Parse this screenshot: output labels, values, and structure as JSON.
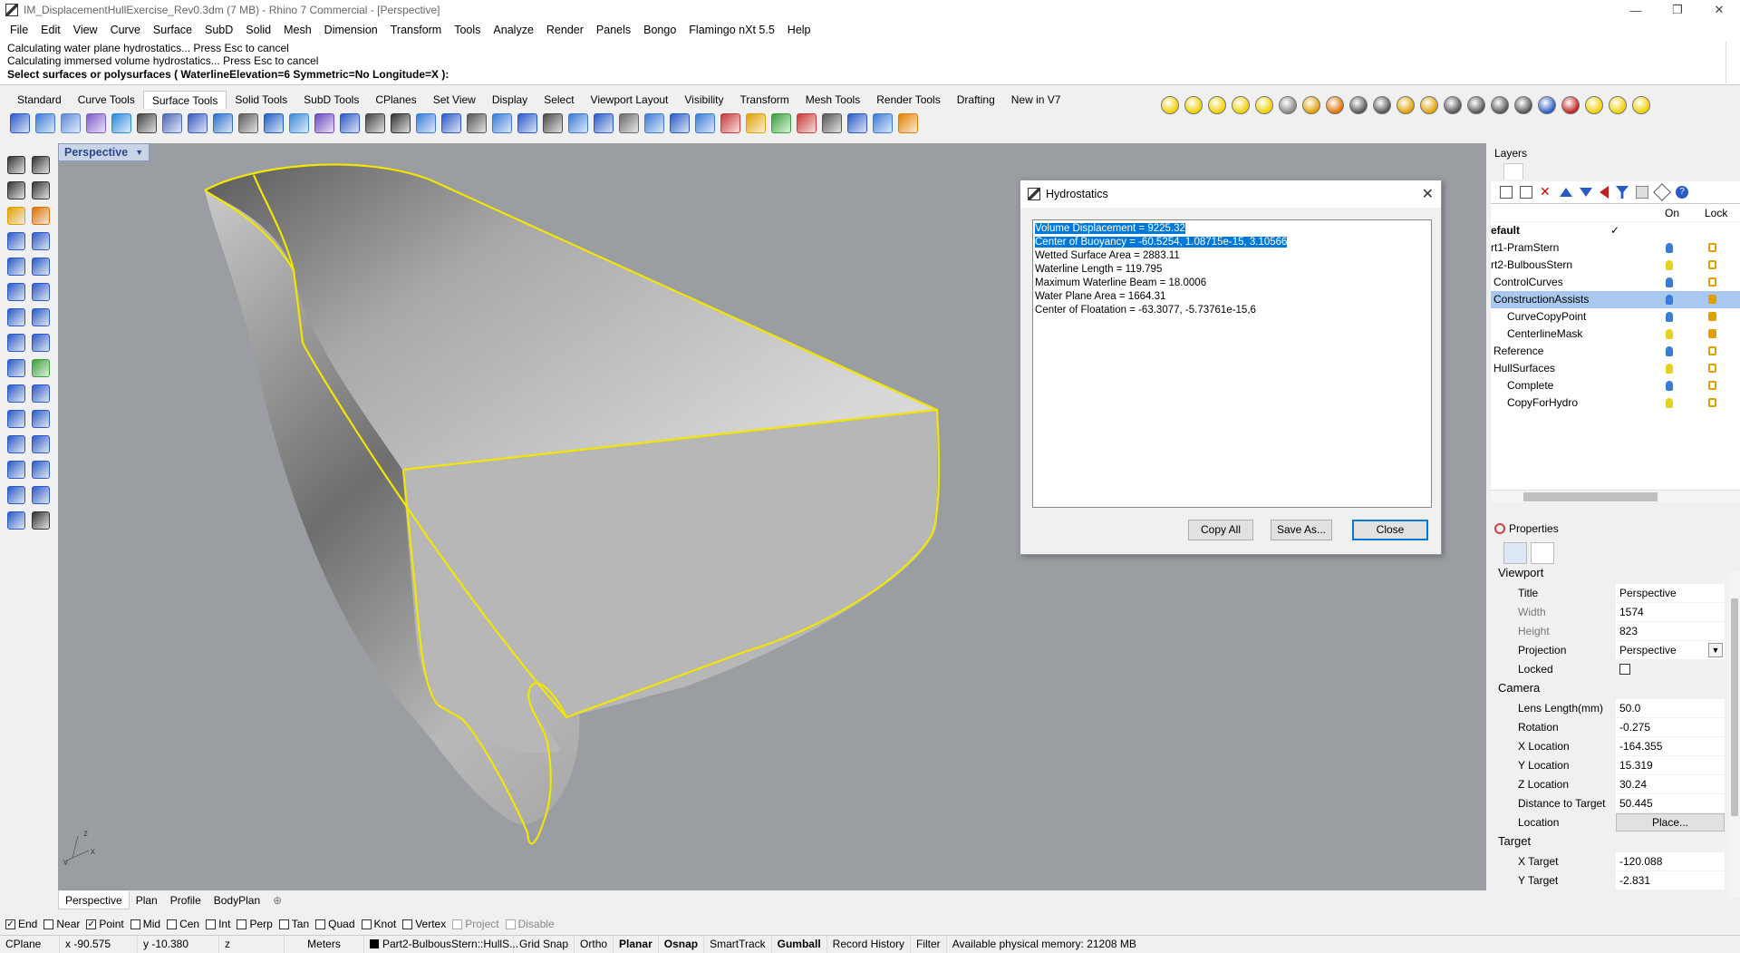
{
  "window": {
    "title": "IM_DisplacementHullExercise_Rev0.3dm (7 MB) - Rhino 7 Commercial - [Perspective]",
    "minimize": "—",
    "maximize": "❐",
    "close": "✕"
  },
  "menu": [
    "File",
    "Edit",
    "View",
    "Curve",
    "Surface",
    "SubD",
    "Solid",
    "Mesh",
    "Dimension",
    "Transform",
    "Tools",
    "Analyze",
    "Render",
    "Panels",
    "Bongo",
    "Flamingo nXt 5.5",
    "Help"
  ],
  "command": {
    "history1": "Calculating water plane hydrostatics... Press Esc to cancel",
    "history2": "Calculating immersed volume hydrostatics... Press Esc to cancel",
    "prompt": "Select surfaces or polysurfaces ( WaterlineElevation=6  Symmetric=No  Longitude=X ):"
  },
  "toolbar_tabs": [
    "Standard",
    "Curve Tools",
    "Surface Tools",
    "Solid Tools",
    "SubD Tools",
    "CPlanes",
    "Set View",
    "Display",
    "Select",
    "Viewport Layout",
    "Visibility",
    "Transform",
    "Mesh Tools",
    "Render Tools",
    "Drafting",
    "New in V7"
  ],
  "active_toolbar_tab": "Surface Tools",
  "viewport": {
    "label": "Perspective",
    "dropdown": "▼",
    "axis_z": "z",
    "axis_x": "x",
    "axis_y": "y"
  },
  "view_tabs": [
    "Perspective",
    "Plan",
    "Profile",
    "BodyPlan"
  ],
  "view_tab_add": "⊕",
  "osnaps": [
    {
      "label": "End",
      "checked": true
    },
    {
      "label": "Near",
      "checked": false
    },
    {
      "label": "Point",
      "checked": true
    },
    {
      "label": "Mid",
      "checked": false
    },
    {
      "label": "Cen",
      "checked": false
    },
    {
      "label": "Int",
      "checked": false
    },
    {
      "label": "Perp",
      "checked": false
    },
    {
      "label": "Tan",
      "checked": false
    },
    {
      "label": "Quad",
      "checked": false
    },
    {
      "label": "Knot",
      "checked": false
    },
    {
      "label": "Vertex",
      "checked": false
    },
    {
      "label": "Project",
      "checked": false,
      "disabled": true
    },
    {
      "label": "Disable",
      "checked": false,
      "disabled": true
    }
  ],
  "status": {
    "cplane": "CPlane",
    "x": "x -90.575",
    "y": "y -10.380",
    "z": "z",
    "units": "Meters",
    "layer": "Part2-BulbousStern::HullS...",
    "grid_snap": "Grid Snap",
    "ortho": "Ortho",
    "planar": "Planar",
    "osnap": "Osnap",
    "smarttrack": "SmartTrack",
    "gumball": "Gumball",
    "record_history": "Record History",
    "filter": "Filter",
    "memory": "Available physical memory: 21208 MB"
  },
  "dialog": {
    "title": "Hydrostatics",
    "close_glyph": "✕",
    "lines": [
      "Volume Displacement = 9225.32",
      "Center of Buoyancy = -60.5254, 1.08715e-15, 3.10566",
      "Wetted Surface Area = 2883.11",
      "Waterline Length = 119.795",
      "Maximum Waterline Beam = 18.0006",
      "Water Plane Area = 1664.31",
      "Center of Floatation = -63.3077, -5.73761e-15,6"
    ],
    "copy_all": "Copy All",
    "save_as": "Save As...",
    "close": "Close"
  },
  "layers": {
    "title": "Layers",
    "col_on": "On",
    "col_lock": "Lock",
    "items": [
      {
        "name": "efault",
        "indent": 0,
        "current": true,
        "check": "✓"
      },
      {
        "name": "rt1-PramStern",
        "indent": 0,
        "bulb": "#3a7bd5",
        "lock": "open"
      },
      {
        "name": "rt2-BulbousStern",
        "indent": 0,
        "bulb": "#e8d020",
        "lock": "open"
      },
      {
        "name": "ControlCurves",
        "indent": 1,
        "bulb": "#3a7bd5",
        "lock": "open"
      },
      {
        "name": "ConstructionAssists",
        "indent": 1,
        "bulb": "#3a7bd5",
        "lock": "closed",
        "selected": true
      },
      {
        "name": "CurveCopyPoint",
        "indent": 2,
        "bulb": "#3a7bd5",
        "lock": "closed"
      },
      {
        "name": "CenterlineMask",
        "indent": 2,
        "bulb": "#e8d020",
        "lock": "closed"
      },
      {
        "name": "Reference",
        "indent": 1,
        "bulb": "#3a7bd5",
        "lock": "open"
      },
      {
        "name": "HullSurfaces",
        "indent": 1,
        "bulb": "#e8d020",
        "lock": "open"
      },
      {
        "name": "Complete",
        "indent": 2,
        "bulb": "#3a7bd5",
        "lock": "open"
      },
      {
        "name": "CopyForHydro",
        "indent": 2,
        "bulb": "#e8d020",
        "lock": "open"
      }
    ]
  },
  "properties": {
    "title": "Properties",
    "viewport_section": "Viewport",
    "camera_section": "Camera",
    "target_section": "Target",
    "viewport_rows": [
      {
        "key": "Title",
        "value": "Perspective"
      },
      {
        "key": "Width",
        "value": "1574",
        "dim": true
      },
      {
        "key": "Height",
        "value": "823",
        "dim": true
      },
      {
        "key": "Projection",
        "value": "Perspective",
        "dropdown": true
      },
      {
        "key": "Locked",
        "checkbox": true
      }
    ],
    "camera_rows": [
      {
        "key": "Lens Length(mm)",
        "value": "50.0"
      },
      {
        "key": "Rotation",
        "value": "-0.275"
      },
      {
        "key": "X Location",
        "value": "-164.355"
      },
      {
        "key": "Y Location",
        "value": "15.319"
      },
      {
        "key": "Z Location",
        "value": "30.24"
      },
      {
        "key": "Distance to Target",
        "value": "50.445"
      },
      {
        "key": "Location",
        "value": "Place...",
        "button": true
      }
    ],
    "target_rows": [
      {
        "key": "X Target",
        "value": "-120.088"
      },
      {
        "key": "Y Target",
        "value": "-2.831"
      }
    ]
  }
}
